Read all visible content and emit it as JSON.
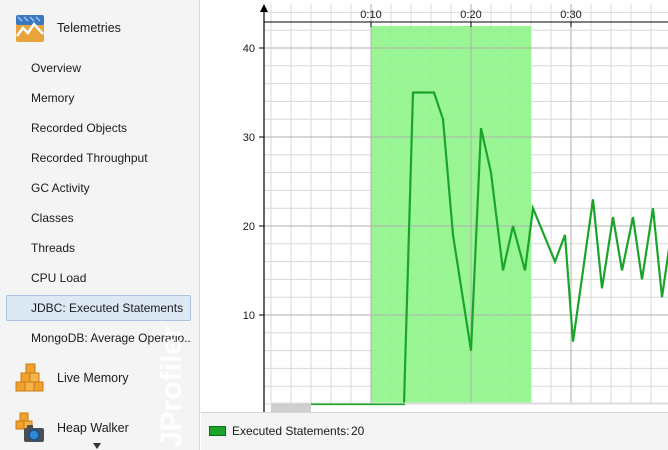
{
  "sidebar": {
    "telemetries": {
      "label": "Telemetries",
      "icon": "telemetries-icon",
      "items": [
        {
          "label": "Overview"
        },
        {
          "label": "Memory"
        },
        {
          "label": "Recorded Objects"
        },
        {
          "label": "Recorded Throughput"
        },
        {
          "label": "GC Activity"
        },
        {
          "label": "Classes"
        },
        {
          "label": "Threads"
        },
        {
          "label": "CPU Load"
        },
        {
          "label": "JDBC: Executed Statements",
          "selected": true
        },
        {
          "label": "MongoDB: Average Operatio..."
        }
      ]
    },
    "live_memory": {
      "label": "Live Memory",
      "icon": "live-memory-icon"
    },
    "heap_walker": {
      "label": "Heap Walker",
      "icon": "heap-walker-icon"
    },
    "watermark": "JProfiler"
  },
  "legend": {
    "label": "Executed Statements:",
    "value": "20",
    "color": "#1aa52a"
  },
  "colors": {
    "selection_bg": "#dde8f5",
    "highlight": "#8ff58a",
    "series": "#1aa52a"
  },
  "chart_data": {
    "type": "line",
    "x_ticks": [
      "0:10",
      "0:20",
      "0:30"
    ],
    "y_ticks": [
      "10",
      "20",
      "30",
      "40"
    ],
    "ylim": [
      0,
      44
    ],
    "xlim": [
      "0:00",
      "0:40"
    ],
    "highlight_range": [
      "0:10",
      "0:26"
    ],
    "grid": true,
    "series": [
      {
        "name": "Executed Statements",
        "color": "#1aa52a",
        "x": [
          3.3,
          13.3,
          14.2,
          16.3,
          17.2,
          18.2,
          20.0,
          21.0,
          22.0,
          23.2,
          24.2,
          25.4,
          26.2,
          28.4,
          29.4,
          30.2,
          32.2,
          33.1,
          34.2,
          35.1,
          36.2,
          37.1,
          38.2,
          39.1,
          40.0
        ],
        "y": [
          0,
          0,
          35,
          35,
          32,
          19,
          6,
          31,
          26,
          15,
          20,
          15,
          22,
          16,
          19,
          7,
          23,
          13,
          21,
          15,
          21,
          14,
          22,
          12,
          19
        ]
      }
    ]
  }
}
